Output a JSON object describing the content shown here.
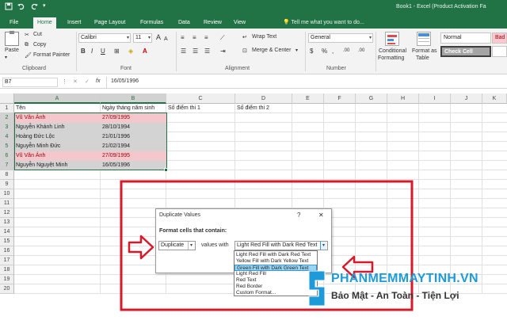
{
  "window": {
    "title": "Book1 - Excel (Product Activation Fa",
    "quick_access": {
      "save_icon": "save-icon",
      "undo_icon": "undo-icon",
      "redo_icon": "redo-icon"
    }
  },
  "ribbon_tabs": [
    "File",
    "Home",
    "Insert",
    "Page Layout",
    "Formulas",
    "Data",
    "Review",
    "View"
  ],
  "active_tab": "Home",
  "tell_me": "Tell me what you want to do...",
  "clipboard": {
    "paste": "Paste",
    "cut": "Cut",
    "copy": "Copy",
    "format_painter": "Format Painter",
    "group": "Clipboard"
  },
  "font": {
    "name": "Calibri",
    "size": "11",
    "bold": "B",
    "italic": "I",
    "underline": "U",
    "grow": "A",
    "shrink": "A",
    "group": "Font"
  },
  "alignment": {
    "wrap_text": "Wrap Text",
    "merge_center": "Merge & Center",
    "group": "Alignment"
  },
  "number": {
    "format": "General",
    "currency": "$",
    "percent": "%",
    "comma": ",",
    "inc_dec": ".00",
    "group": "Number"
  },
  "styles": {
    "conditional_formatting": "Conditional",
    "conditional_formatting_2": "Formatting",
    "format_as_table": "Format as",
    "format_as_table_2": "Table",
    "normal": "Normal",
    "bad": "Bad",
    "check_cell": "Check Cell"
  },
  "formula_bar": {
    "name_box": "B7",
    "fx": "fx",
    "value": "16/05/1996"
  },
  "columns": [
    "A",
    "B",
    "C",
    "D",
    "E",
    "F",
    "G",
    "H",
    "I",
    "J",
    "K"
  ],
  "rows": [
    "1",
    "2",
    "3",
    "4",
    "5",
    "6",
    "7",
    "8",
    "9",
    "10",
    "11",
    "12",
    "13",
    "14",
    "15",
    "16",
    "17",
    "18",
    "19",
    "20"
  ],
  "sheet": {
    "headers": {
      "a": "Tên",
      "b": "Ngày tháng năm sinh",
      "c": "Số điểm thi 1",
      "d": "Số điểm thi 2"
    },
    "records": [
      {
        "name": "Vũ Văn Ánh",
        "dob": "27/09/1995",
        "duplicate": true
      },
      {
        "name": "Nguyễn Khánh Linh",
        "dob": "28/10/1994",
        "duplicate": false
      },
      {
        "name": "Hoàng Đức Lộc",
        "dob": "21/01/1996",
        "duplicate": false
      },
      {
        "name": "Nguyễn Minh Đức",
        "dob": "21/02/1994",
        "duplicate": false
      },
      {
        "name": "Vũ Văn Ánh",
        "dob": "27/09/1995",
        "duplicate": true
      },
      {
        "name": "Nguyễn Nguyệt Minh",
        "dob": "16/05/1996",
        "duplicate": false
      }
    ]
  },
  "dialog": {
    "title": "Duplicate Values",
    "help": "?",
    "close": "✕",
    "instruction": "Format cells that contain:",
    "type_value": "Duplicate",
    "values_with_label": "values with",
    "format_value": "Light Red Fill with Dark Red Text",
    "options": [
      "Light Red Fill with Dark Red Text",
      "Yellow Fill with Dark Yellow Text",
      "Green Fill with Dark Green Text",
      "Light Red Fill",
      "Red Text",
      "Red Border",
      "Custom Format..."
    ],
    "highlighted_option": 2
  },
  "watermark": {
    "title": "PHANMEMMAYTINH.VN",
    "subtitle": "Bảo Mật - An Toàn - Tiện Lợi"
  },
  "colors": {
    "excel_green": "#217346",
    "dup_fill": "#f4c7cd",
    "dup_text": "#9c0006",
    "selection_fill": "#d3d3d3",
    "annotation_red": "#d8192a",
    "watermark_blue": "#1d9bd8"
  }
}
